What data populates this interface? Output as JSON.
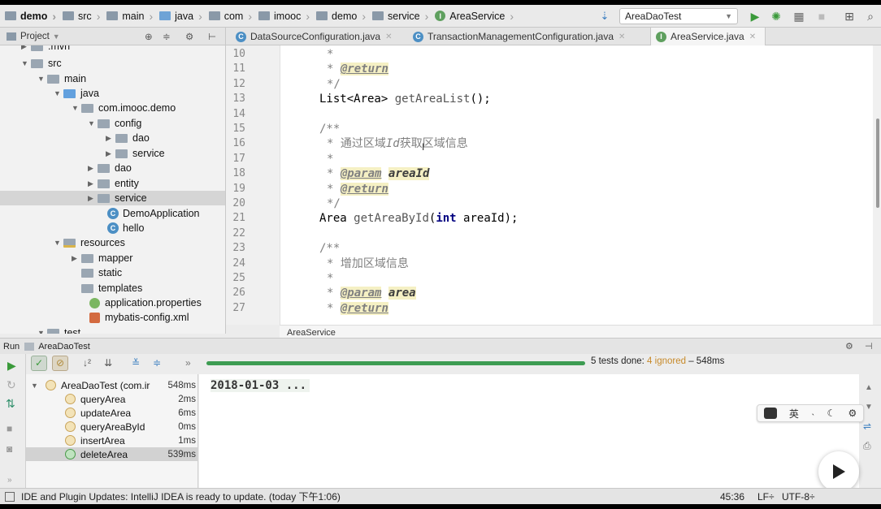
{
  "navbar": {
    "crumbs": [
      "demo",
      "src",
      "main",
      "java",
      "com",
      "imooc",
      "demo",
      "service",
      "AreaService"
    ],
    "run_config": "AreaDaoTest"
  },
  "project_panel": {
    "title": "Project"
  },
  "tabs": [
    {
      "label": "DataSourceConfiguration.java",
      "kind": "C"
    },
    {
      "label": "TransactionManagementConfiguration.java",
      "kind": "C"
    },
    {
      "label": "AreaService.java",
      "kind": "I"
    }
  ],
  "tree": {
    "items": [
      {
        "label": ".mvn"
      },
      {
        "label": "src"
      },
      {
        "label": "main"
      },
      {
        "label": "java"
      },
      {
        "label": "com.imooc.demo"
      },
      {
        "label": "config"
      },
      {
        "label": "dao"
      },
      {
        "label": "service"
      },
      {
        "label": "dao"
      },
      {
        "label": "entity"
      },
      {
        "label": "service"
      },
      {
        "label": "DemoApplication"
      },
      {
        "label": "hello"
      },
      {
        "label": "resources"
      },
      {
        "label": "mapper"
      },
      {
        "label": "static"
      },
      {
        "label": "templates"
      },
      {
        "label": "application.properties"
      },
      {
        "label": "mybatis-config.xml"
      },
      {
        "label": "test"
      }
    ]
  },
  "editor": {
    "line_numbers": [
      "10",
      "11",
      "12",
      "13",
      "14",
      "15",
      "16",
      "17",
      "18",
      "19",
      "20",
      "21",
      "22",
      "23",
      "24",
      "25",
      "26",
      "27"
    ],
    "lines": {
      "l10": "*",
      "l11_star": "*",
      "l11_tag": "@return",
      "l12": "*/",
      "l13_a": "List<Area> ",
      "l13_b": "getAreaList",
      "l13_c": "();",
      "l15": "/**",
      "l16_a": "* 通过区域",
      "l16_b": "Id",
      "l16_c": "获取区域信息",
      "l17": "*",
      "l18_star": "*",
      "l18_tag": "@param",
      "l18_name": "areaId",
      "l19_star": "*",
      "l19_tag": "@return",
      "l20": "*/",
      "l21_a": "Area ",
      "l21_b": "getAreaById",
      "l21_c": "(",
      "l21_d": "int",
      "l21_e": " areaId);",
      "l23": "/**",
      "l24": "* 增加区域信息",
      "l25": "*",
      "l26_star": "*",
      "l26_tag": "@param",
      "l26_name": "area",
      "l27_star": "*",
      "l27_tag": "@return"
    },
    "breadcrumb": "AreaService"
  },
  "run": {
    "label": "Run",
    "config": "AreaDaoTest",
    "summary_done": "5 tests done: ",
    "summary_ignored": "4 ignored",
    "summary_time": " – 548ms",
    "progress": 1.0,
    "tests": [
      {
        "name": "AreaDaoTest (com.ir",
        "time": "548ms"
      },
      {
        "name": "queryArea",
        "time": "2ms"
      },
      {
        "name": "updateArea",
        "time": "6ms"
      },
      {
        "name": "queryAreaById",
        "time": "0ms"
      },
      {
        "name": "insertArea",
        "time": "1ms"
      },
      {
        "name": "deleteArea",
        "time": "539ms"
      }
    ],
    "console": "2018-01-03 ..."
  },
  "ime": {
    "en_cn": "英",
    "punct": "˴"
  },
  "status": {
    "message": "IDE and Plugin Updates: IntelliJ IDEA is ready to update. (today 下午1:06)",
    "position": "45:36",
    "line_sep": "LF÷",
    "encoding": "UTF-8÷"
  },
  "colors": {
    "accent_green": "#3d9c52",
    "ignored": "#c78a2a",
    "keyword": "#000080"
  }
}
